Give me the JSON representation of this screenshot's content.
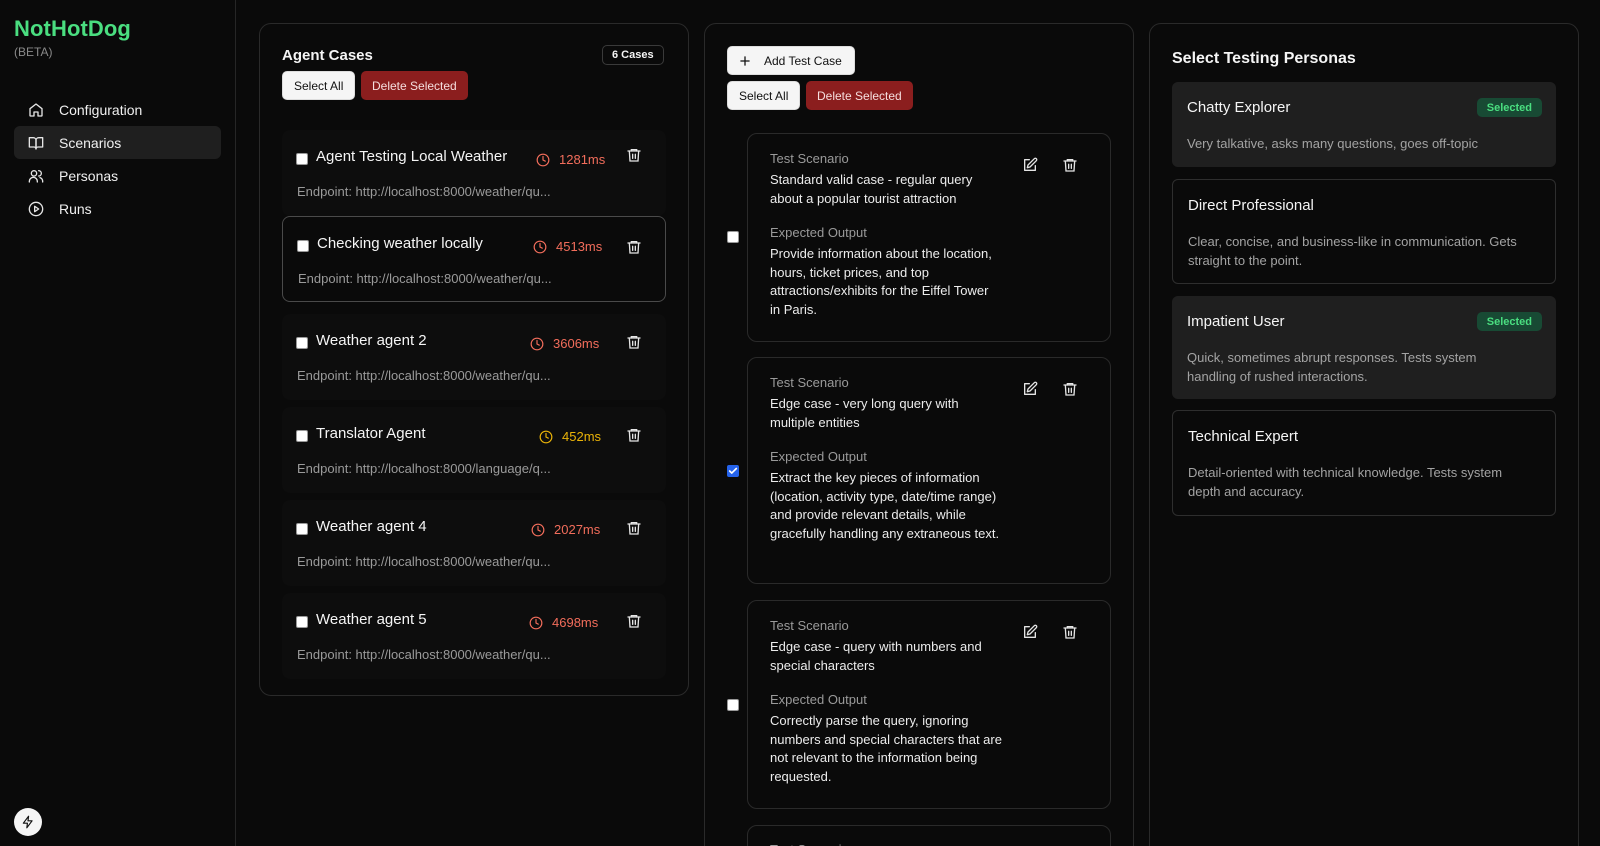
{
  "app": {
    "name": "NotHotDog",
    "beta": "(BETA)"
  },
  "nav": {
    "items": [
      {
        "label": "Configuration",
        "icon": "home-icon"
      },
      {
        "label": "Scenarios",
        "icon": "book-icon",
        "active": true
      },
      {
        "label": "Personas",
        "icon": "users-icon"
      },
      {
        "label": "Runs",
        "icon": "play-circle-icon"
      }
    ]
  },
  "agent_cases": {
    "title": "Agent Cases",
    "count": "6 Cases",
    "select_all": "Select All",
    "delete_selected": "Delete Selected",
    "items": [
      {
        "name": "Agent Testing Local Weather",
        "time": "1281ms",
        "endpoint": "Endpoint: http://localhost:8000/weather/qu..."
      },
      {
        "name": "Checking weather locally",
        "time": "4513ms",
        "endpoint": "Endpoint: http://localhost:8000/weather/qu..."
      },
      {
        "name": "Weather agent 2",
        "time": "3606ms",
        "endpoint": "Endpoint: http://localhost:8000/weather/qu..."
      },
      {
        "name": "Translator Agent",
        "time": "452ms",
        "endpoint": "Endpoint: http://localhost:8000/language/q..."
      },
      {
        "name": "Weather agent 4",
        "time": "2027ms",
        "endpoint": "Endpoint: http://localhost:8000/weather/qu..."
      },
      {
        "name": "Weather agent 5",
        "time": "4698ms",
        "endpoint": "Endpoint: http://localhost:8000/weather/qu..."
      }
    ]
  },
  "test_cases": {
    "add_label": "Add Test Case",
    "select_all": "Select All",
    "delete_selected": "Delete Selected",
    "scenario_label": "Test Scenario",
    "output_label": "Expected Output",
    "items": [
      {
        "scenario": "Standard valid case - regular query about a popular tourist attraction",
        "output": "Provide information about the location, hours, ticket prices, and top attractions/exhibits for the Eiffel Tower in Paris.",
        "checked": false
      },
      {
        "scenario": "Edge case - very long query with multiple entities",
        "output": "Extract the key pieces of information (location, activity type, date/time range) and provide relevant details, while gracefully handling any extraneous text.",
        "checked": true
      },
      {
        "scenario": "Edge case - query with numbers and special characters",
        "output": "Correctly parse the query, ignoring numbers and special characters that are not relevant to the information being requested.",
        "checked": false
      }
    ]
  },
  "personas": {
    "title": "Select Testing Personas",
    "selected_label": "Selected",
    "items": [
      {
        "name": "Chatty Explorer",
        "desc": "Very talkative, asks many questions, goes off-topic",
        "selected": true
      },
      {
        "name": "Direct Professional",
        "desc": "Clear, concise, and business-like in communication. Gets straight to the point.",
        "selected": false
      },
      {
        "name": "Impatient User",
        "desc": "Quick, sometimes abrupt responses. Tests system handling of rushed interactions.",
        "selected": true
      },
      {
        "name": "Technical Expert",
        "desc": "Detail-oriented with technical knowledge. Tests system depth and accuracy.",
        "selected": false
      }
    ]
  },
  "colors": {
    "brand": "#4ade80",
    "danger": "#8b1e1e",
    "time_red": "#f26d5b",
    "time_yellow": "#eab308"
  }
}
